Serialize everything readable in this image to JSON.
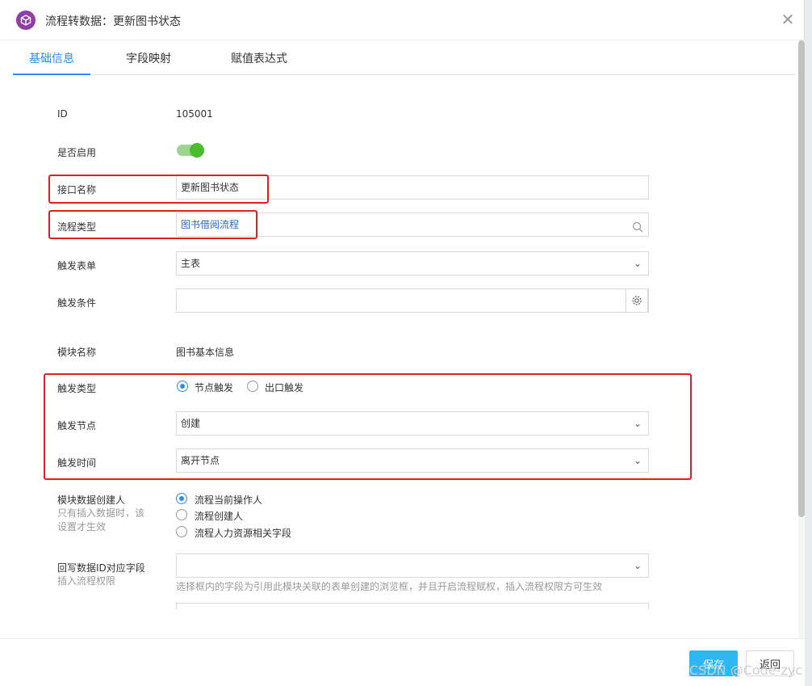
{
  "dialog": {
    "title": "流程转数据：更新图书状态"
  },
  "tabs": [
    {
      "label": "基础信息"
    },
    {
      "label": "字段映射"
    },
    {
      "label": "赋值表达式"
    }
  ],
  "form": {
    "id_label": "ID",
    "id_value": "105001",
    "enabled_label": "是否启用",
    "enabled": true,
    "api_name_label": "接口名称",
    "api_name_value": "更新图书状态",
    "flow_type_label": "流程类型",
    "flow_type_value": "图书借阅流程",
    "trigger_form_label": "触发表单",
    "trigger_form_value": "主表",
    "trigger_cond_label": "触发条件",
    "trigger_cond_value": "",
    "module_name_label": "模块名称",
    "module_name_value": "图书基本信息",
    "trigger_type_label": "触发类型",
    "trigger_type_options": [
      "节点触发",
      "出口触发"
    ],
    "trigger_node_label": "触发节点",
    "trigger_node_value": "创建",
    "trigger_time_label": "触发时间",
    "trigger_time_value": "离开节点",
    "creator_label": "模块数据创建人",
    "creator_sub1": "只有插入数据时，该",
    "creator_sub2": "设置才生效",
    "creator_options": [
      "流程当前操作人",
      "流程创建人",
      "流程人力资源相关字段"
    ],
    "writeback_label": "回写数据ID对应字段",
    "writeback_sub": "插入流程权限",
    "writeback_value": "",
    "writeback_hint": "选择框内的字段为引用此模块关联的表单创建的浏览框，并且开启流程赋权，插入流程权限方可生效"
  },
  "footer": {
    "save_label": "保存",
    "back_label": "返回"
  },
  "watermark": "CSDN @Code-zyc",
  "colors": {
    "accent": "#2d8cf0",
    "save": "#2db7f5",
    "toggle": "#4cbc2f",
    "highlight": "#e02020"
  }
}
